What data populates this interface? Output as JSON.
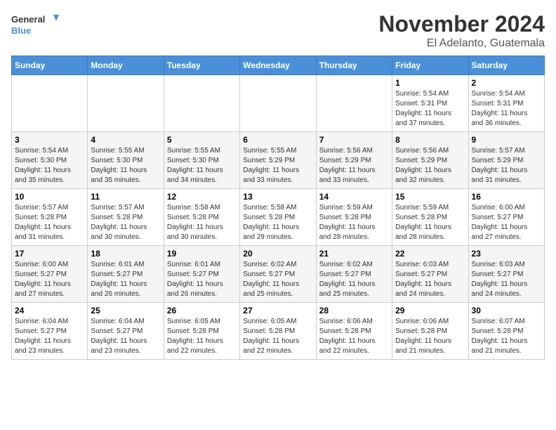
{
  "header": {
    "logo_line1": "General",
    "logo_line2": "Blue",
    "month": "November 2024",
    "location": "El Adelanto, Guatemala"
  },
  "weekdays": [
    "Sunday",
    "Monday",
    "Tuesday",
    "Wednesday",
    "Thursday",
    "Friday",
    "Saturday"
  ],
  "weeks": [
    [
      {
        "day": "",
        "info": ""
      },
      {
        "day": "",
        "info": ""
      },
      {
        "day": "",
        "info": ""
      },
      {
        "day": "",
        "info": ""
      },
      {
        "day": "",
        "info": ""
      },
      {
        "day": "1",
        "info": "Sunrise: 5:54 AM\nSunset: 5:31 PM\nDaylight: 11 hours\nand 37 minutes."
      },
      {
        "day": "2",
        "info": "Sunrise: 5:54 AM\nSunset: 5:31 PM\nDaylight: 11 hours\nand 36 minutes."
      }
    ],
    [
      {
        "day": "3",
        "info": "Sunrise: 5:54 AM\nSunset: 5:30 PM\nDaylight: 11 hours\nand 35 minutes."
      },
      {
        "day": "4",
        "info": "Sunrise: 5:55 AM\nSunset: 5:30 PM\nDaylight: 11 hours\nand 35 minutes."
      },
      {
        "day": "5",
        "info": "Sunrise: 5:55 AM\nSunset: 5:30 PM\nDaylight: 11 hours\nand 34 minutes."
      },
      {
        "day": "6",
        "info": "Sunrise: 5:55 AM\nSunset: 5:29 PM\nDaylight: 11 hours\nand 33 minutes."
      },
      {
        "day": "7",
        "info": "Sunrise: 5:56 AM\nSunset: 5:29 PM\nDaylight: 11 hours\nand 33 minutes."
      },
      {
        "day": "8",
        "info": "Sunrise: 5:56 AM\nSunset: 5:29 PM\nDaylight: 11 hours\nand 32 minutes."
      },
      {
        "day": "9",
        "info": "Sunrise: 5:57 AM\nSunset: 5:29 PM\nDaylight: 11 hours\nand 31 minutes."
      }
    ],
    [
      {
        "day": "10",
        "info": "Sunrise: 5:57 AM\nSunset: 5:28 PM\nDaylight: 11 hours\nand 31 minutes."
      },
      {
        "day": "11",
        "info": "Sunrise: 5:57 AM\nSunset: 5:28 PM\nDaylight: 11 hours\nand 30 minutes."
      },
      {
        "day": "12",
        "info": "Sunrise: 5:58 AM\nSunset: 5:28 PM\nDaylight: 11 hours\nand 30 minutes."
      },
      {
        "day": "13",
        "info": "Sunrise: 5:58 AM\nSunset: 5:28 PM\nDaylight: 11 hours\nand 29 minutes."
      },
      {
        "day": "14",
        "info": "Sunrise: 5:59 AM\nSunset: 5:28 PM\nDaylight: 11 hours\nand 28 minutes."
      },
      {
        "day": "15",
        "info": "Sunrise: 5:59 AM\nSunset: 5:28 PM\nDaylight: 11 hours\nand 28 minutes."
      },
      {
        "day": "16",
        "info": "Sunrise: 6:00 AM\nSunset: 5:27 PM\nDaylight: 11 hours\nand 27 minutes."
      }
    ],
    [
      {
        "day": "17",
        "info": "Sunrise: 6:00 AM\nSunset: 5:27 PM\nDaylight: 11 hours\nand 27 minutes."
      },
      {
        "day": "18",
        "info": "Sunrise: 6:01 AM\nSunset: 5:27 PM\nDaylight: 11 hours\nand 26 minutes."
      },
      {
        "day": "19",
        "info": "Sunrise: 6:01 AM\nSunset: 5:27 PM\nDaylight: 11 hours\nand 26 minutes."
      },
      {
        "day": "20",
        "info": "Sunrise: 6:02 AM\nSunset: 5:27 PM\nDaylight: 11 hours\nand 25 minutes."
      },
      {
        "day": "21",
        "info": "Sunrise: 6:02 AM\nSunset: 5:27 PM\nDaylight: 11 hours\nand 25 minutes."
      },
      {
        "day": "22",
        "info": "Sunrise: 6:03 AM\nSunset: 5:27 PM\nDaylight: 11 hours\nand 24 minutes."
      },
      {
        "day": "23",
        "info": "Sunrise: 6:03 AM\nSunset: 5:27 PM\nDaylight: 11 hours\nand 24 minutes."
      }
    ],
    [
      {
        "day": "24",
        "info": "Sunrise: 6:04 AM\nSunset: 5:27 PM\nDaylight: 11 hours\nand 23 minutes."
      },
      {
        "day": "25",
        "info": "Sunrise: 6:04 AM\nSunset: 5:27 PM\nDaylight: 11 hours\nand 23 minutes."
      },
      {
        "day": "26",
        "info": "Sunrise: 6:05 AM\nSunset: 5:28 PM\nDaylight: 11 hours\nand 22 minutes."
      },
      {
        "day": "27",
        "info": "Sunrise: 6:05 AM\nSunset: 5:28 PM\nDaylight: 11 hours\nand 22 minutes."
      },
      {
        "day": "28",
        "info": "Sunrise: 6:06 AM\nSunset: 5:28 PM\nDaylight: 11 hours\nand 22 minutes."
      },
      {
        "day": "29",
        "info": "Sunrise: 6:06 AM\nSunset: 5:28 PM\nDaylight: 11 hours\nand 21 minutes."
      },
      {
        "day": "30",
        "info": "Sunrise: 6:07 AM\nSunset: 5:28 PM\nDaylight: 11 hours\nand 21 minutes."
      }
    ]
  ]
}
